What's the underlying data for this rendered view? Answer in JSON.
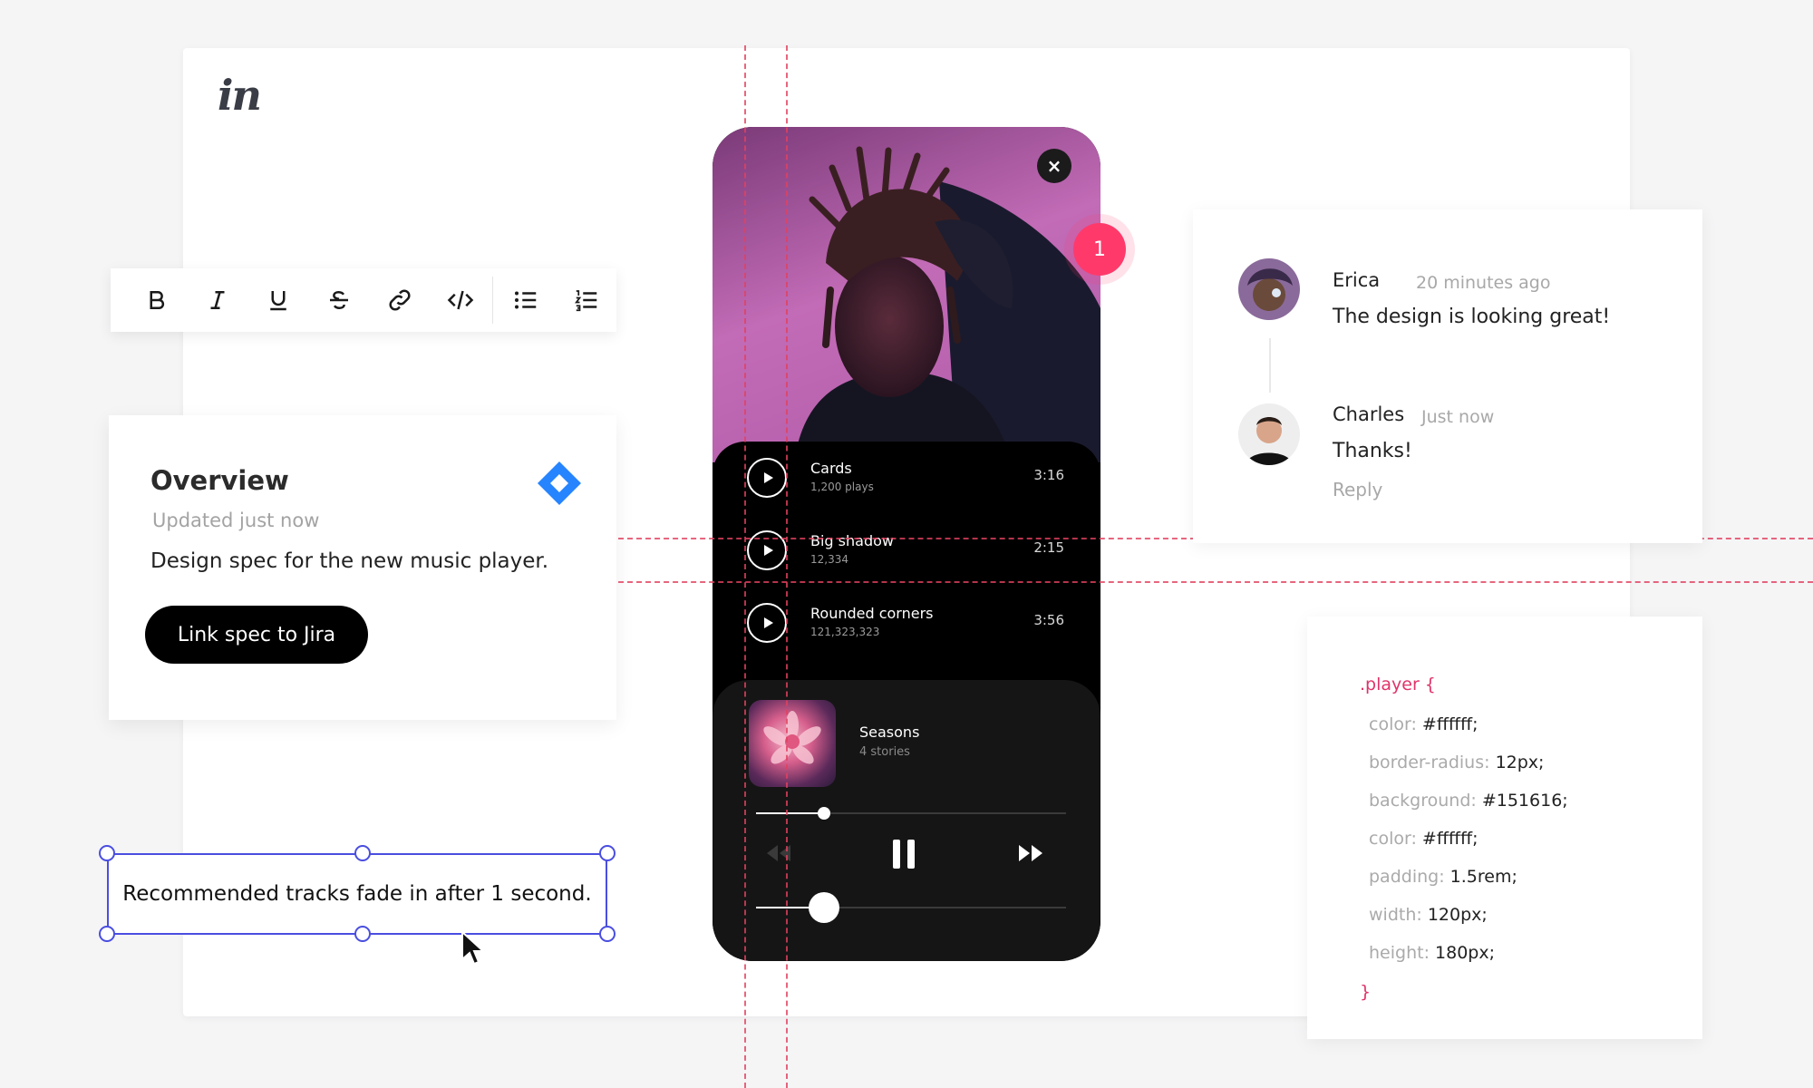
{
  "app": {
    "logo": "in"
  },
  "toolbar": {
    "buttons": [
      "bold-button",
      "italic-button",
      "underline-button",
      "strikethrough-button",
      "link-button",
      "code-button",
      "bullet-list-button",
      "numbered-list-button"
    ]
  },
  "overview": {
    "title": "Overview",
    "updated": "Updated just now",
    "description": "Design spec for the new music player.",
    "button_label": "Link spec to Jira",
    "jira_color": "#2684ff"
  },
  "annotation": {
    "text": "Recommended tracks fade in after 1 second."
  },
  "player": {
    "tracks": [
      {
        "name": "Cards",
        "plays": "1,200 plays",
        "duration": "3:16"
      },
      {
        "name": "Big shadow",
        "plays": "12,334",
        "duration": "2:15"
      },
      {
        "name": "Rounded corners",
        "plays": "121,323,323",
        "duration": "3:56"
      }
    ],
    "now_playing": {
      "title": "Seasons",
      "subtitle": "4 stories"
    },
    "progress": 0.22,
    "volume": 0.22,
    "close_icon": "×"
  },
  "badge": {
    "count": "1",
    "color": "#ff3a6b"
  },
  "comments": [
    {
      "name": "Erica",
      "time": "20 minutes ago",
      "text": "The design is looking great!"
    },
    {
      "name": "Charles",
      "time": "Just now",
      "text": "Thanks!"
    }
  ],
  "reply_label": "Reply",
  "code": {
    "selector": ".player {",
    "lines": [
      {
        "prop": "color:",
        "val": "#ffffff;"
      },
      {
        "prop": "border-radius:",
        "val": "12px;"
      },
      {
        "prop": "background:",
        "val": "#151616;"
      },
      {
        "prop": "color:",
        "val": "#ffffff;"
      },
      {
        "prop": "padding:",
        "val": "1.5rem;"
      },
      {
        "prop": "width:",
        "val": "120px;"
      },
      {
        "prop": "height:",
        "val": "180px;"
      }
    ],
    "close": "}",
    "accent": "#e0336a"
  },
  "guide_color": "#e2415f",
  "selection_color": "#4a4ee0"
}
